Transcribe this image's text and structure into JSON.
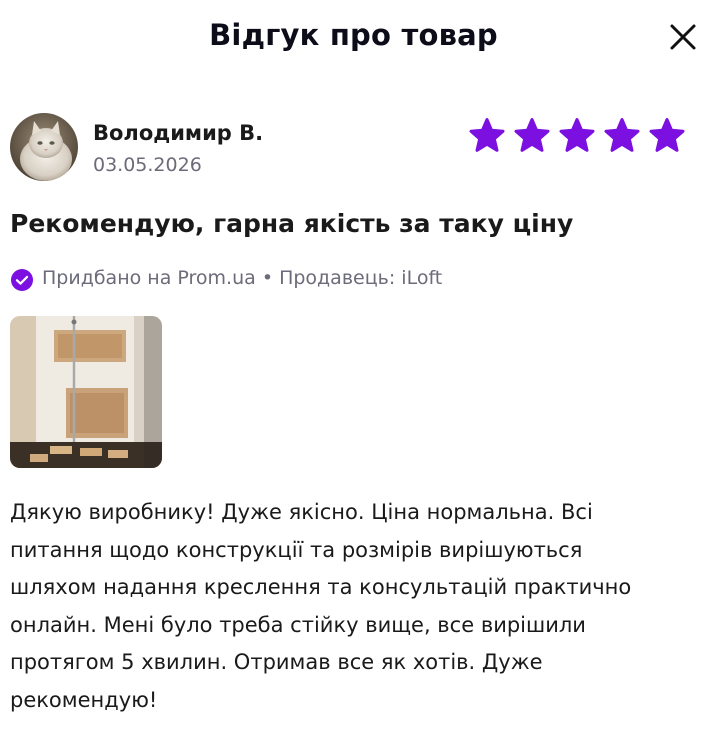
{
  "modal": {
    "title": "Відгук про товар",
    "close_icon": "close-icon"
  },
  "author": {
    "name": "Володимир В.",
    "date": "03.05.2026",
    "avatar_icon": "cat-avatar"
  },
  "rating": {
    "value": 5,
    "max": 5,
    "color": "#7b10e0"
  },
  "review": {
    "title": "Рекомендую, гарна якість за таку ціну",
    "purchase_text": "Придбано на Prom.ua",
    "separator": "•",
    "seller_text": "Продавець: iLoft",
    "verified_icon": "verified-check-icon",
    "verified_color": "#7b10e0",
    "body_lines": [
      "Дякую виробнику! Дуже якісно. Ціна нормальна. Всі",
      "питання щодо конструкції та розмірів вирішуються",
      "шляхом надання креслення та консультацій практично",
      "онлайн. Мені було треба стійку вище, все вирішили",
      "протягом 5 хвилин. Отримав все як хотів. Дуже",
      "рекомендую!"
    ]
  }
}
